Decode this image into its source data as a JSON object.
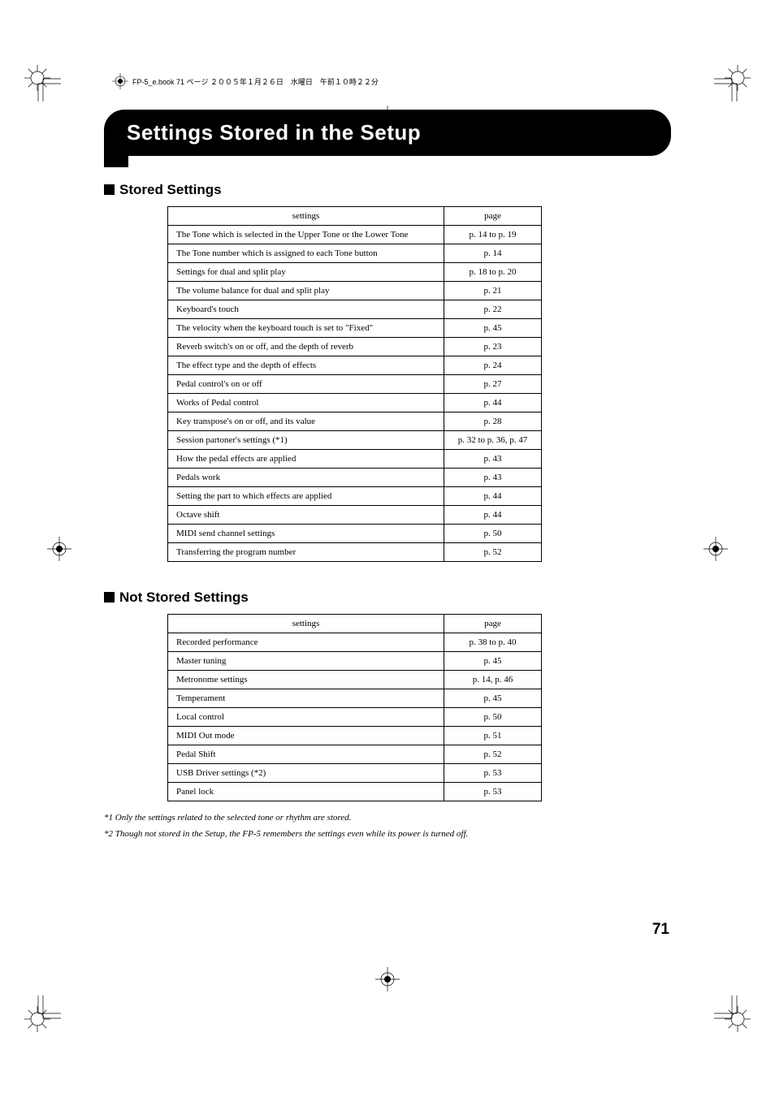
{
  "header_info": "FP-5_e.book 71 ページ ２００５年１月２６日　水曜日　午前１０時２２分",
  "title": "Settings Stored in the Setup",
  "sections": {
    "stored": {
      "heading": "Stored Settings",
      "columns": {
        "settings": "settings",
        "page": "page"
      },
      "rows": [
        {
          "setting": "The Tone which is selected in the Upper Tone or the Lower Tone",
          "page": "p. 14 to p. 19"
        },
        {
          "setting": "The Tone number which is assigned to each Tone button",
          "page": "p. 14"
        },
        {
          "setting": "Settings for dual and split play",
          "page": "p. 18 to p. 20"
        },
        {
          "setting": "The volume balance for dual and split play",
          "page": "p. 21"
        },
        {
          "setting": "Keyboard's touch",
          "page": "p. 22"
        },
        {
          "setting": "The velocity when the keyboard touch is set to \"Fixed\"",
          "page": "p. 45"
        },
        {
          "setting": "Reverb switch's on or off, and the depth of reverb",
          "page": "p. 23"
        },
        {
          "setting": "The effect type and the depth of effects",
          "page": "p. 24"
        },
        {
          "setting": "Pedal control's on or off",
          "page": "p. 27"
        },
        {
          "setting": "Works of Pedal control",
          "page": "p. 44"
        },
        {
          "setting": "Key transpose's on or off, and its value",
          "page": "p. 28"
        },
        {
          "setting": "Session partoner's settings (*1)",
          "page": "p. 32 to p. 36, p. 47"
        },
        {
          "setting": "How the pedal effects are applied",
          "page": "p. 43"
        },
        {
          "setting": "Pedals work",
          "page": "p. 43"
        },
        {
          "setting": "Setting the part to which effects are applied",
          "page": "p. 44"
        },
        {
          "setting": "Octave shift",
          "page": "p. 44"
        },
        {
          "setting": "MIDI send channel settings",
          "page": "p. 50"
        },
        {
          "setting": "Transferring the program number",
          "page": "p. 52"
        }
      ]
    },
    "not_stored": {
      "heading": "Not Stored Settings",
      "columns": {
        "settings": "settings",
        "page": "page"
      },
      "rows": [
        {
          "setting": "Recorded performance",
          "page": "p. 38 to p. 40"
        },
        {
          "setting": "Master tuning",
          "page": "p. 45"
        },
        {
          "setting": "Metronome settings",
          "page": "p. 14, p. 46"
        },
        {
          "setting": "Temperament",
          "page": "p. 45"
        },
        {
          "setting": "Local control",
          "page": "p. 50"
        },
        {
          "setting": "MIDI Out mode",
          "page": "p. 51"
        },
        {
          "setting": "Pedal Shift",
          "page": "p. 52"
        },
        {
          "setting": "USB Driver settings (*2)",
          "page": "p. 53"
        },
        {
          "setting": "Panel lock",
          "page": "p. 53"
        }
      ]
    }
  },
  "footnotes": {
    "f1": "*1 Only the settings related to the selected tone or rhythm are stored.",
    "f2": "*2 Though not stored in the Setup, the FP-5 remembers the settings even while its power is turned off."
  },
  "page_number": "71"
}
